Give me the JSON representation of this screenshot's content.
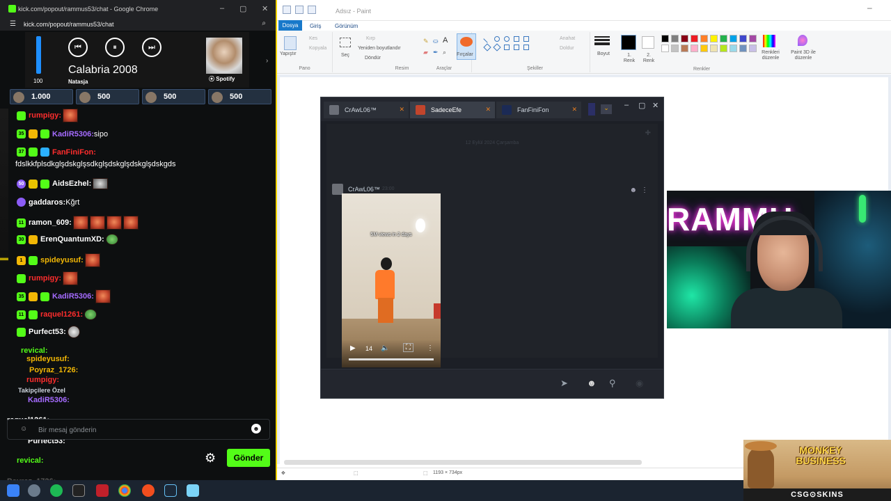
{
  "paint": {
    "title": "Adsız - Paint",
    "menu": {
      "file": "Dosya",
      "home": "Giriş",
      "view": "Görünüm"
    },
    "groups": {
      "clipboard": "Pano",
      "image": "Resim",
      "tools": "Araçlar",
      "shapes": "Şekiller",
      "colors": "Renkler"
    },
    "items": {
      "paste": "Yapıştır",
      "cut": "Kes",
      "copy": "Kopyala",
      "select": "Seç",
      "crop": "Kırp",
      "resize": "Yeniden boyutlandır",
      "rotate": "Döndür",
      "brushes": "Fırçalar",
      "outline": "Anahat",
      "fill": "Doldur",
      "size": "Boyut",
      "color1": "1. Renk",
      "color2": "2. Renk",
      "edit_colors": "Renkleri düzenle",
      "paint3d": "Paint 3D ile düzenle"
    },
    "status_size": "1193 × 734px",
    "palette": [
      "#000000",
      "#7f7f7f",
      "#880015",
      "#ed1c24",
      "#ff7f27",
      "#fff200",
      "#22b14c",
      "#00a2e8",
      "#3f48cc",
      "#a349a4",
      "#ffffff",
      "#c3c3c3",
      "#b97a57",
      "#ffaec9",
      "#ffc90e",
      "#efe4b0",
      "#b5e61d",
      "#99d9ea",
      "#7092be",
      "#c8bfe7"
    ]
  },
  "steam": {
    "tabs": [
      {
        "name": "CrAwL06™"
      },
      {
        "name": "SadeceEfe"
      },
      {
        "name": "FanFiniFon"
      }
    ],
    "date_separator": "12 Eylül 2024 Çarşamba",
    "message": {
      "author": "CrAwL06™",
      "time": "23:00"
    },
    "video": {
      "caption": "5M views in 2 days",
      "time": "14"
    }
  },
  "chrome": {
    "window_title": "kick.com/popout/rammus53/chat - Google Chrome",
    "url": "kick.com/popout/rammus53/chat"
  },
  "spotify": {
    "volume": "100",
    "volume_level": 1.0,
    "song": "Calabria 2008",
    "artist": "Natasja",
    "brand": "Spotify"
  },
  "leaderboard": [
    {
      "amount": "1.000"
    },
    {
      "amount": "500"
    },
    {
      "amount": "500"
    },
    {
      "amount": "500"
    }
  ],
  "chat": [
    {
      "badges": [
        "b-sub"
      ],
      "user": "rumpigy:",
      "color": "#ff2d2d",
      "text": "",
      "emotes": [
        "emote"
      ]
    },
    {
      "badges": [
        "b-num",
        "b-gold",
        "b-sub"
      ],
      "num": "35",
      "user": "KadiR5306:",
      "color": "#a56bff",
      "text": " sipo",
      "emotes": []
    },
    {
      "badges": [
        "b-num",
        "b-sub",
        "b-blue"
      ],
      "num": "37",
      "user": "FanFiniFon:",
      "color": "#ff2d2d",
      "text": "",
      "emotes": []
    },
    {
      "badges": [],
      "user": "",
      "color": "#fff",
      "text": "fdslkkfplsdkglşdskglşsdkglşdskglşdskglşdskgds",
      "emotes": []
    },
    {
      "badges": [
        "b-purple",
        "b-vip",
        "b-sub"
      ],
      "num": "50",
      "user": "AidsEzhel:",
      "color": "#fff",
      "text": " ",
      "emotes": [
        "emote mono"
      ]
    },
    {
      "badges": [
        "b-purple"
      ],
      "user": "gaddaros:",
      "color": "#fff",
      "text": " Kğrt",
      "emotes": []
    },
    {
      "badges": [
        "b-num"
      ],
      "num": "11",
      "user": "ramon_609:",
      "color": "#fff",
      "text": " ",
      "emotes": [
        "emote",
        "emote",
        "emote",
        "emote"
      ]
    },
    {
      "badges": [
        "b-num",
        "b-gold"
      ],
      "num": "30",
      "user": "ErenQuantumXD:",
      "color": "#fff",
      "text": " ",
      "emotes": [
        "emote pepe"
      ]
    },
    {
      "badges": [
        "b-gold",
        "b-sub"
      ],
      "num": "1",
      "user": "spideyusuf:",
      "color": "#f2b705",
      "text": " ",
      "emotes": [
        "emote"
      ]
    },
    {
      "badges": [
        "b-sub"
      ],
      "user": "rumpigy:",
      "color": "#ff2d2d",
      "text": " ",
      "emotes": [
        "emote"
      ]
    },
    {
      "badges": [
        "b-num",
        "b-gold",
        "b-sub"
      ],
      "num": "35",
      "user": "KadiR5306:",
      "color": "#a56bff",
      "text": " ",
      "emotes": [
        "emote"
      ]
    },
    {
      "badges": [
        "b-num",
        "b-sub"
      ],
      "num": "11",
      "user": "raquel1261:",
      "color": "#ff2d2d",
      "text": " ",
      "emotes": [
        "emote pepe"
      ]
    },
    {
      "badges": [
        "b-sub"
      ],
      "user": "Purfect53:",
      "color": "#fff",
      "text": " ",
      "emotes": [
        "emote wave"
      ]
    }
  ],
  "chat_overlap": [
    {
      "user": "revical:",
      "color": "#53fc18"
    },
    {
      "user": "spideyusuf:",
      "color": "#f2b705"
    },
    {
      "user": "Poyraz_1726:",
      "color": "#f2b705"
    },
    {
      "user": "rumpigy:",
      "color": "#ff2d2d"
    },
    {
      "user": "Takipçilere Özel",
      "color": "#cfd6df"
    },
    {
      "user": "KadiR5306:",
      "color": "#a56bff"
    },
    {
      "user": "raquel1261:",
      "color": "#ffffff"
    },
    {
      "user": "Purfect53:",
      "color": "#ffffff"
    },
    {
      "user": "revical:",
      "color": "#53fc18"
    },
    {
      "user": "Poyraz_1726:",
      "color": "#555555"
    }
  ],
  "chat_input": {
    "placeholder": "Bir mesaj gönderin"
  },
  "send_label": "Gönder",
  "promo": {
    "title": "MONKEY BUSINESS",
    "brand": "CSG⊙SKINS"
  },
  "colors": {
    "kick_green": "#53fc18",
    "paint_blue": "#1979ca"
  }
}
